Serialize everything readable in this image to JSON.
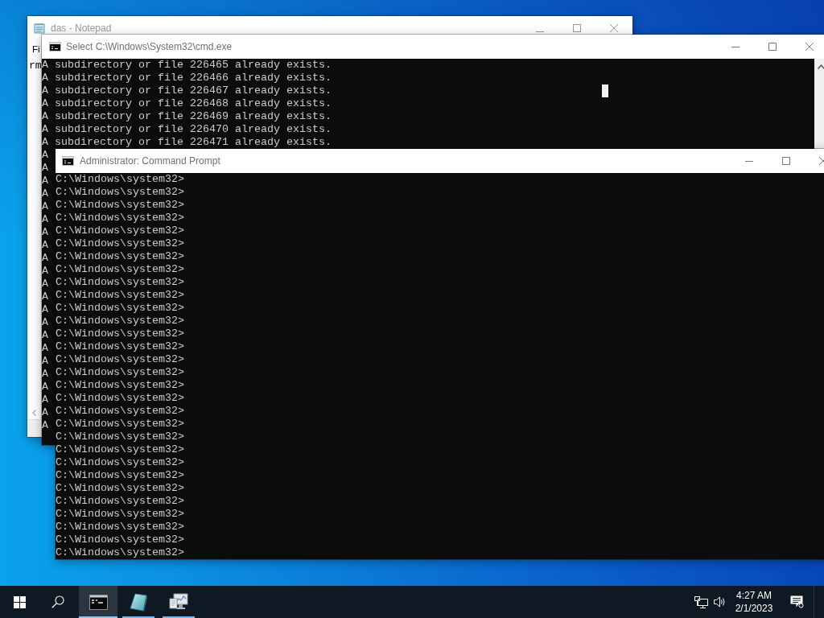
{
  "notepad_window": {
    "title": "das - Notepad",
    "menu": [
      "Fi"
    ],
    "text": "rm"
  },
  "cmd_window": {
    "title": "Select C:\\Windows\\System32\\cmd.exe",
    "lines": [
      "A subdirectory or file 226465 already exists.",
      "A subdirectory or file 226466 already exists.",
      "A subdirectory or file 226467 already exists.",
      "A subdirectory or file 226468 already exists.",
      "A subdirectory or file 226469 already exists.",
      "A subdirectory or file 226470 already exists.",
      "A subdirectory or file 226471 already exists.",
      "A",
      "A",
      "A",
      "A",
      "A",
      "A",
      "A",
      "A",
      "A",
      "A",
      "A",
      "A",
      "A",
      "A",
      "A",
      "A",
      "A",
      "A",
      "A",
      "A",
      "A",
      "A"
    ]
  },
  "admin_window": {
    "title": "Administrator: Command Prompt",
    "lines": [
      "C:\\Windows\\system32>",
      "C:\\Windows\\system32>",
      "C:\\Windows\\system32>",
      "C:\\Windows\\system32>",
      "C:\\Windows\\system32>",
      "C:\\Windows\\system32>",
      "C:\\Windows\\system32>",
      "C:\\Windows\\system32>",
      "C:\\Windows\\system32>",
      "C:\\Windows\\system32>",
      "C:\\Windows\\system32>",
      "C:\\Windows\\system32>",
      "C:\\Windows\\system32>",
      "C:\\Windows\\system32>",
      "C:\\Windows\\system32>",
      "C:\\Windows\\system32>",
      "C:\\Windows\\system32>",
      "C:\\Windows\\system32>",
      "C:\\Windows\\system32>",
      "C:\\Windows\\system32>",
      "C:\\Windows\\system32>",
      "C:\\Windows\\system32>",
      "C:\\Windows\\system32>",
      "C:\\Windows\\system32>",
      "C:\\Windows\\system32>",
      "C:\\Windows\\system32>",
      "C:\\Windows\\system32>",
      "C:\\Windows\\system32>",
      "C:\\Windows\\system32>",
      "C:\\Windows\\system32>"
    ]
  },
  "taskbar": {
    "apps": [
      {
        "kind": "terminal",
        "selected": true
      },
      {
        "kind": "notepad",
        "selected": false
      },
      {
        "kind": "dashboard",
        "selected": false
      }
    ],
    "clock": {
      "time": "4:27 AM",
      "date": "2/1/2023"
    }
  }
}
